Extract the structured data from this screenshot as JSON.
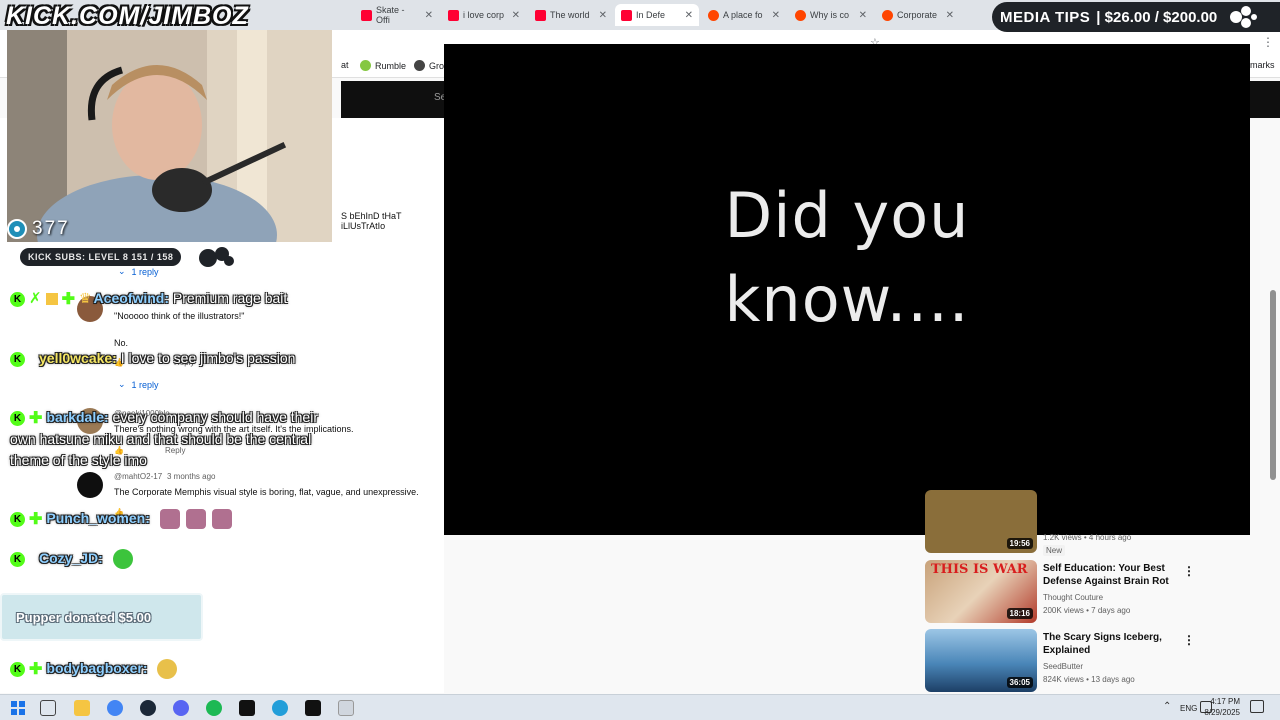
{
  "overlay": {
    "url_watermark": "KICK.COM/JIMBOZ",
    "media_tips_label": "MEDIA TIPS",
    "media_tips_amount": "| $26.00 / $200.00",
    "viewer_count": "377",
    "kick_subs": "KICK SUBS: LEVEL 8 151 / 158",
    "donation": "Pupper donated $5.00"
  },
  "browser": {
    "tabs": [
      {
        "title": "Skate - Offi",
        "color": "#ff0033"
      },
      {
        "title": "i love corp",
        "color": "#ff0033"
      },
      {
        "title": "The world",
        "color": "#ff0033"
      },
      {
        "title": "In Defe",
        "color": "#ff0033"
      },
      {
        "title": "A place fo",
        "color": "#ff4500"
      },
      {
        "title": "Why is co",
        "color": "#ff4500"
      },
      {
        "title": "Corporate",
        "color": "#ff4500"
      }
    ],
    "bookmarks": [
      {
        "label": "at",
        "color": "#ffffff"
      },
      {
        "label": "Rumble",
        "color": "#85c742"
      },
      {
        "label": "Groy",
        "color": "#444444"
      },
      {
        "label": "marks",
        "color": "#ffffff"
      }
    ]
  },
  "youtube": {
    "search_fragment": "Se",
    "comment_fragment": "S bEhInD tHaT iLlUsTrAtIo",
    "comments": [
      {
        "reply": "1 reply"
      },
      {
        "author": "@",
        "text": "\"Nooooo think of the illustrators!\"",
        "text2": "No.",
        "reply_action": "Reply",
        "reply": "1 reply"
      },
      {
        "author": "@naoki1000blo",
        "text": "There's nothing wrong with the art itself. It's the implications.",
        "reply_action": "Reply"
      },
      {
        "author": "@mahtO2-17",
        "time": "3 months ago",
        "text": "The Corporate Memphis visual style is boring, flat, vague, and unexpressive.",
        "reply_action": "Re"
      }
    ]
  },
  "chat": [
    {
      "user": "Aceofwind:",
      "message": "Premium rage bait",
      "color": "#8ecfff"
    },
    {
      "user": "yell0wcake:",
      "message": "I love to see jimbo's passion",
      "color": "#f5e663"
    },
    {
      "user": "barkdale:",
      "message": "every company should have their own hatsune miku and that should be the central theme of the style imo",
      "color": "#8ecfff"
    },
    {
      "user": "Punch_women:",
      "message": "",
      "color": "#8ecfff"
    },
    {
      "user": "Cozy_JD:",
      "message": "",
      "color": "#8ecfff"
    },
    {
      "user": "bodybagboxer:",
      "message": "",
      "color": "#8ecfff"
    }
  ],
  "player": {
    "line1": "Did you",
    "line2": "know...."
  },
  "recommendations": [
    {
      "title": "",
      "channel": "",
      "stats": "1.2K views • 4 hours ago",
      "badge": "New",
      "duration": "19:56",
      "thumb": "#8a6e3a"
    },
    {
      "title": "Self Education: Your Best Defense Against Brain Rot",
      "channel": "Thought Couture",
      "stats": "200K views • 7 days ago",
      "duration": "18:16",
      "thumb": "#b23a2a"
    },
    {
      "title": "The Scary Signs Iceberg, Explained",
      "channel": "SeedButter",
      "stats": "824K views • 13 days ago",
      "duration": "36:05",
      "thumb": "#4a86b8"
    }
  ],
  "taskbar": {
    "lang": "ENG",
    "time": "4:17 PM",
    "date": "8/29/2025"
  },
  "colors": {
    "kick_green": "#53fc18",
    "youtube_link": "#065fd4"
  }
}
